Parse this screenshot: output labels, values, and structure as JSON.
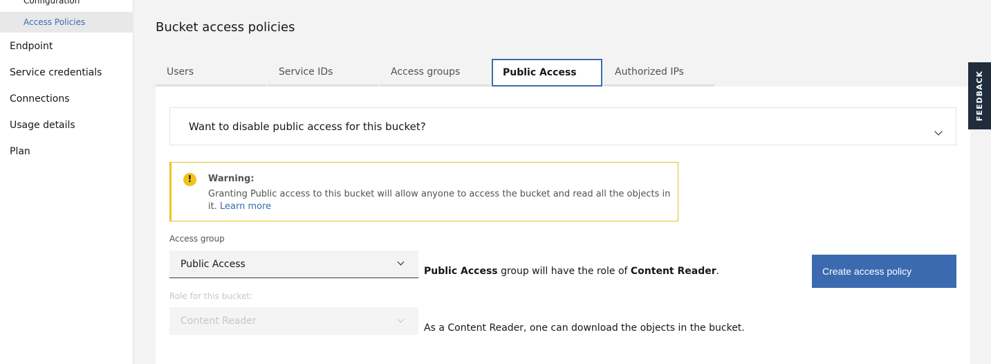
{
  "sidebar": {
    "sub_items": [
      {
        "label": "Configuration"
      },
      {
        "label": "Access Policies"
      }
    ],
    "items": [
      {
        "label": "Endpoint"
      },
      {
        "label": "Service credentials"
      },
      {
        "label": "Connections"
      },
      {
        "label": "Usage details"
      },
      {
        "label": "Plan"
      }
    ]
  },
  "page": {
    "title": "Bucket access policies"
  },
  "tabs": [
    {
      "label": "Users"
    },
    {
      "label": "Service IDs"
    },
    {
      "label": "Access groups"
    },
    {
      "label": "Public Access"
    },
    {
      "label": "Authorized IPs"
    }
  ],
  "accordion": {
    "title": "Want to disable public access for this bucket?"
  },
  "warning": {
    "title": "Warning:",
    "text": "Granting Public access to this bucket will allow anyone to access the bucket and read all the objects in it.",
    "link": "Learn more"
  },
  "access_group": {
    "label": "Access group",
    "value": "Public Access",
    "desc_strong1": "Public Access",
    "desc_mid": " group will have the role of ",
    "desc_strong2": "Content Reader",
    "desc_end": "."
  },
  "role": {
    "label": "Role for this bucket:",
    "value": "Content Reader",
    "desc": "As a Content Reader, one can download the objects in the bucket."
  },
  "create_button": "Create access policy",
  "feedback": "FEEDBACK"
}
